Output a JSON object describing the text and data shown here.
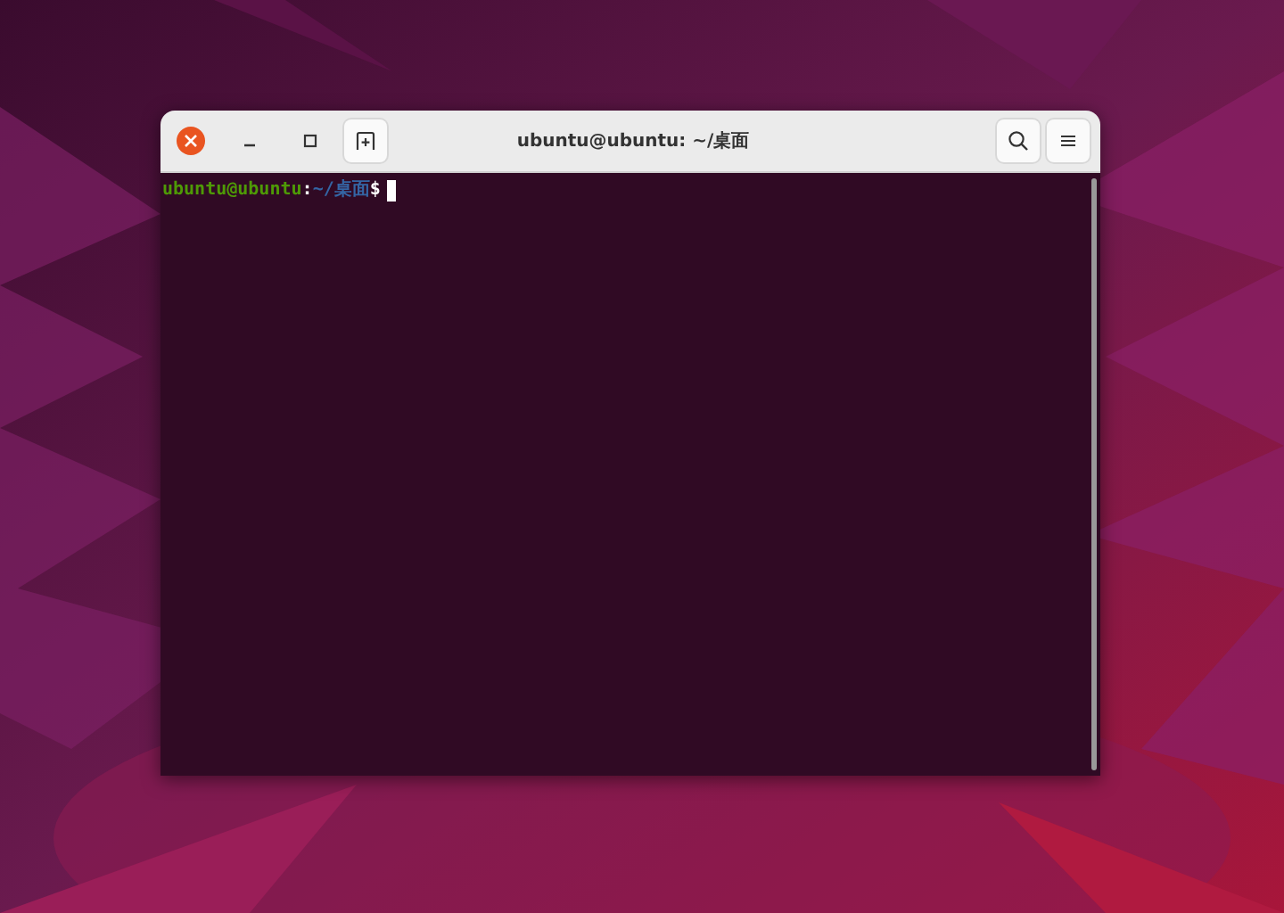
{
  "window": {
    "title": "ubuntu@ubuntu: ~/桌面"
  },
  "terminal": {
    "prompt": {
      "user_host": "ubuntu@ubuntu",
      "separator": ":",
      "path": "~/桌面",
      "symbol": "$"
    }
  }
}
